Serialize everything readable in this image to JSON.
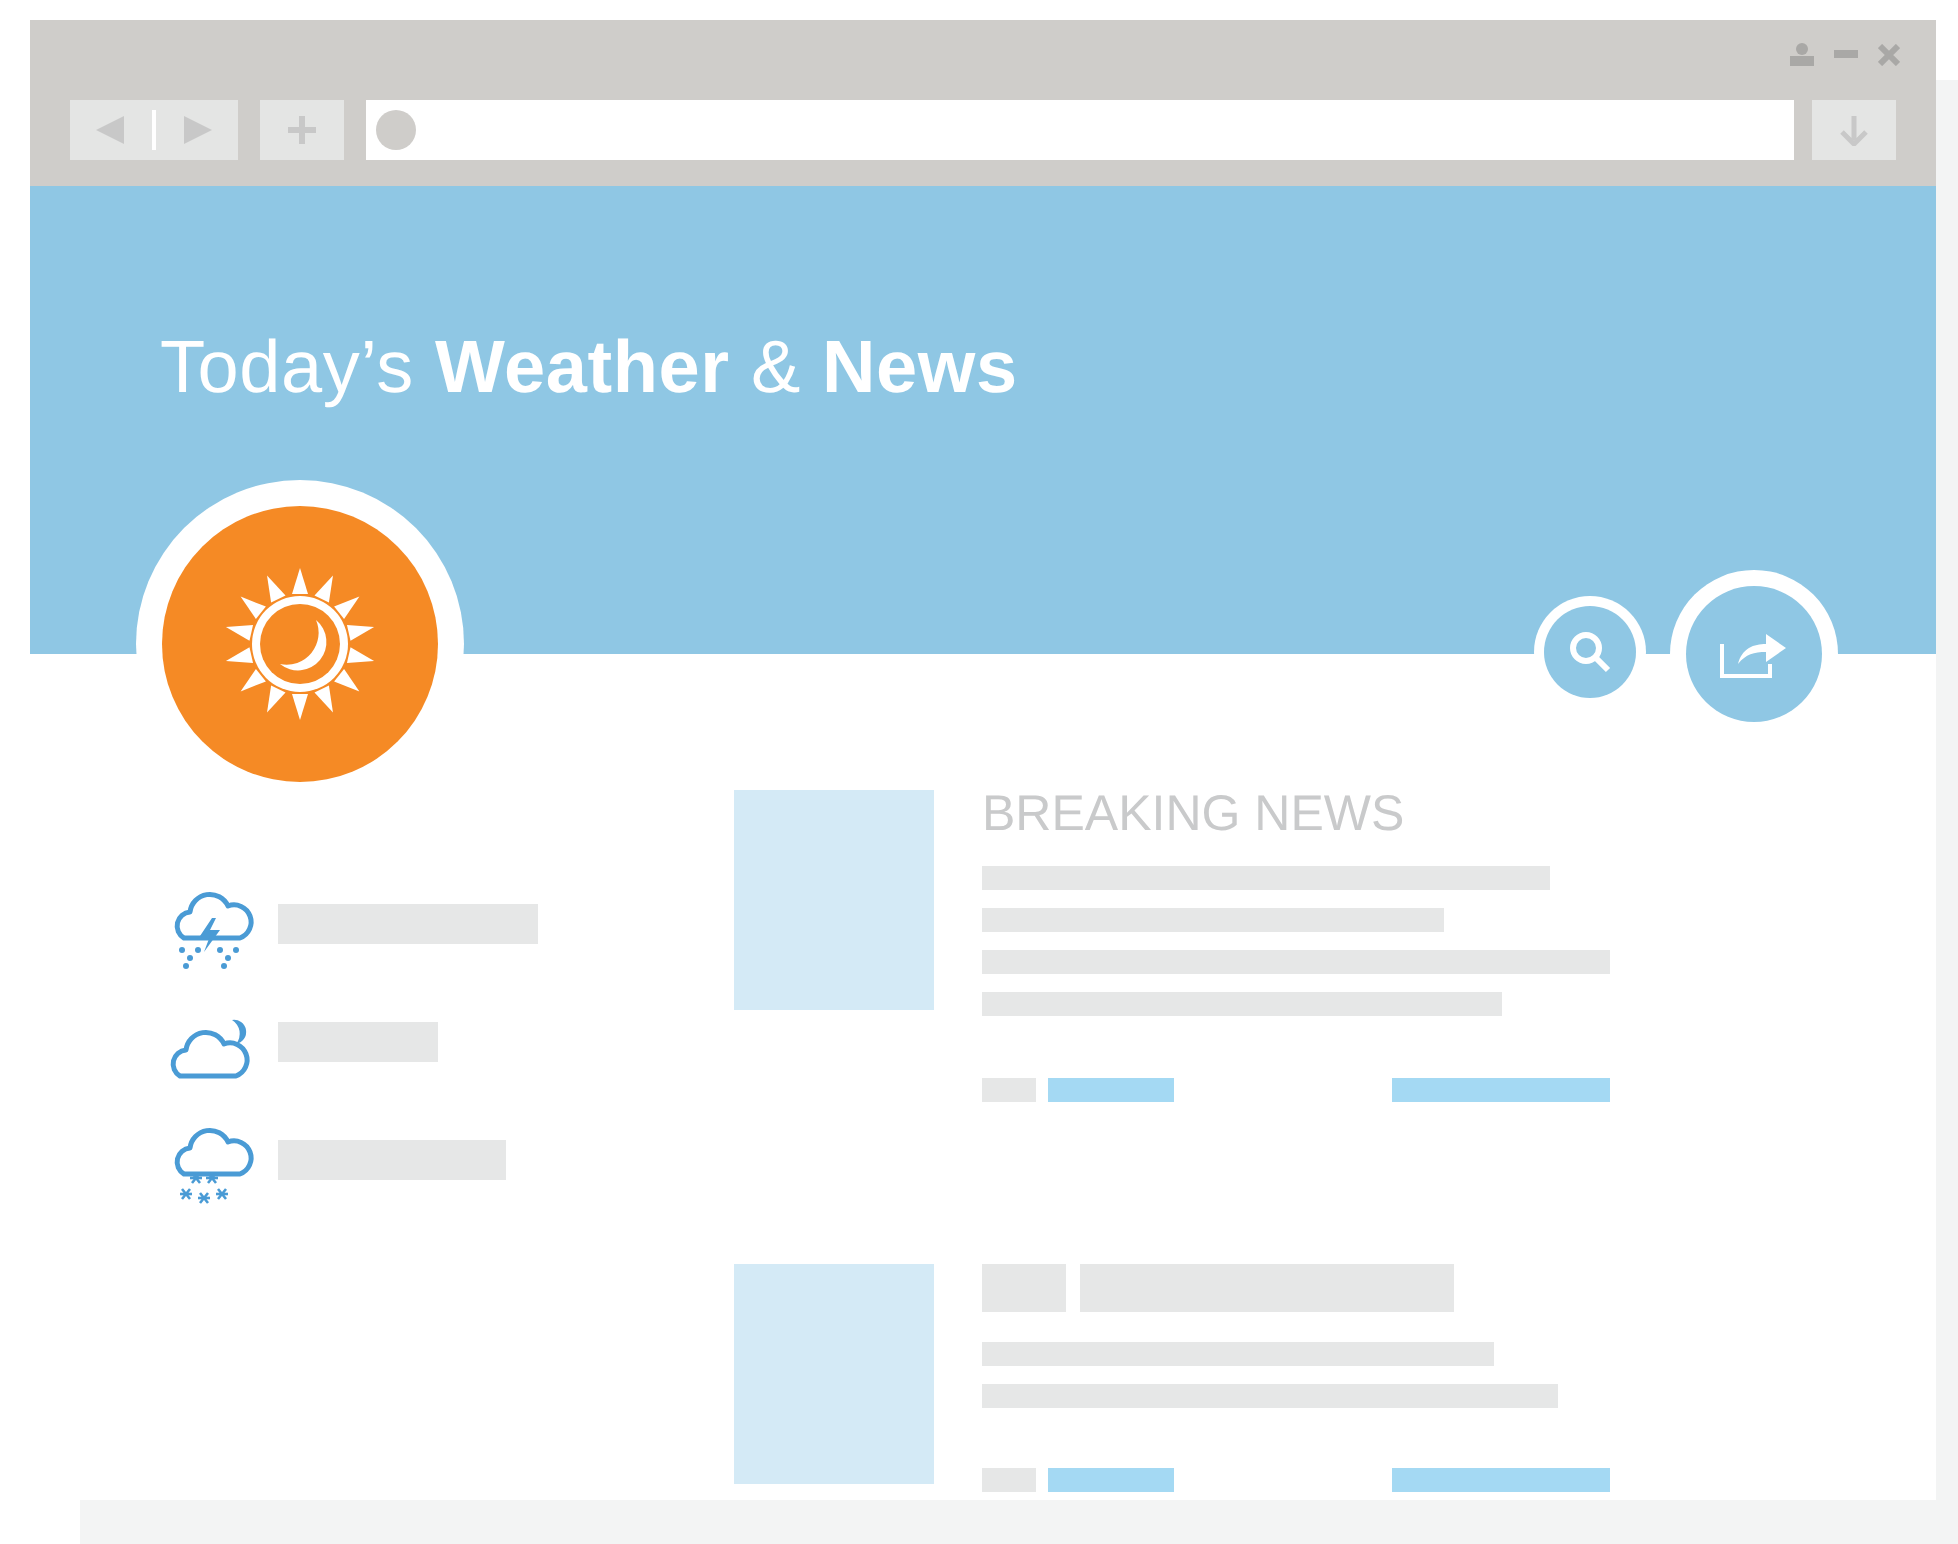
{
  "page": {
    "title": "Today’s **Weather** & **News**"
  },
  "weather": [
    {
      "kind": "storm"
    },
    {
      "kind": "partly_cloudy"
    },
    {
      "kind": "snow"
    }
  ],
  "news": {
    "heading": "BREAKING NEWS"
  }
}
